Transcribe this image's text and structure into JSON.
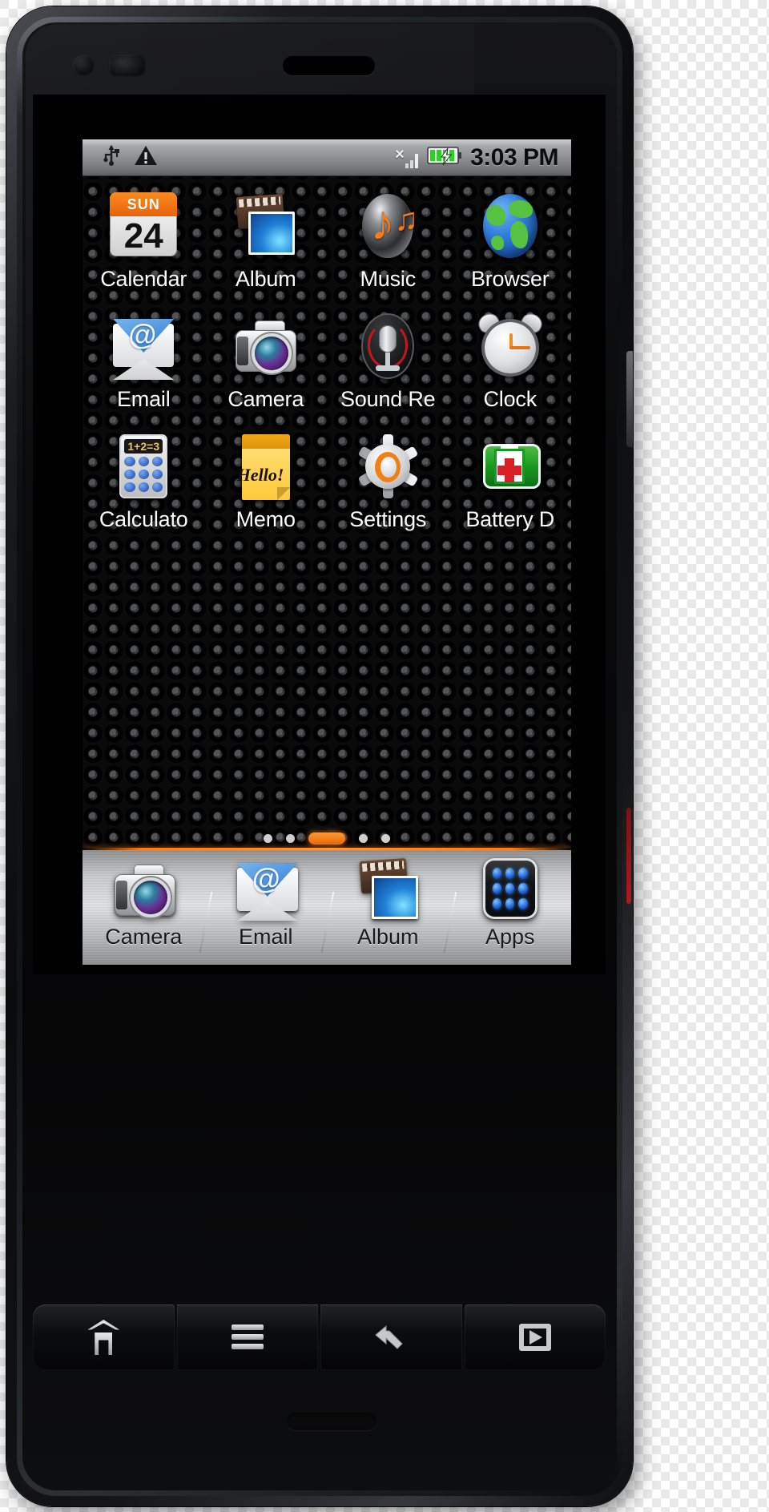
{
  "device": {
    "name": "android-smartphone",
    "front_camera": "front-camera",
    "proximity_sensor": "proximity-sensor",
    "earpiece": "earpiece-speaker",
    "bottom_mic": "bottom-microphone"
  },
  "statusbar": {
    "time": "3:03 PM",
    "icons": [
      {
        "name": "usb-icon",
        "glyph": "⑂"
      },
      {
        "name": "warning-icon",
        "glyph": "⚠"
      }
    ],
    "signal": {
      "name": "signal-no-service-icon",
      "x_mark": "×",
      "bars": 3,
      "active_bars": 0
    },
    "battery": {
      "name": "battery-charging-icon",
      "level": 4,
      "charging": true,
      "color": "#3ddc35"
    },
    "bar_color": "#9a9b9c"
  },
  "homescreen": {
    "rows": [
      {
        "apps": [
          {
            "name": "app-calendar",
            "label": "Calendar",
            "icon": "calendar-icon",
            "weekday": "SUN",
            "day": "24"
          },
          {
            "name": "app-album",
            "label": "Album",
            "icon": "album-icon"
          },
          {
            "name": "app-music",
            "label": "Music",
            "icon": "music-icon"
          },
          {
            "name": "app-browser",
            "label": "Browser",
            "icon": "browser-globe-icon"
          }
        ]
      },
      {
        "apps": [
          {
            "name": "app-email",
            "label": "Email",
            "icon": "email-envelope-icon",
            "at": "@"
          },
          {
            "name": "app-camera",
            "label": "Camera",
            "icon": "camera-icon"
          },
          {
            "name": "app-sound-recorder",
            "label": "Sound Re",
            "icon": "microphone-icon"
          },
          {
            "name": "app-clock",
            "label": "Clock",
            "icon": "alarm-clock-icon"
          }
        ]
      },
      {
        "apps": [
          {
            "name": "app-calculator",
            "label": "Calculato",
            "icon": "calculator-icon",
            "display": "1+2=3"
          },
          {
            "name": "app-memo",
            "label": "Memo",
            "icon": "memo-notepad-icon",
            "note": "Hello!"
          },
          {
            "name": "app-settings",
            "label": "Settings",
            "icon": "gear-icon"
          },
          {
            "name": "app-battery-doctor",
            "label": "Battery D",
            "icon": "battery-doctor-icon"
          }
        ]
      }
    ],
    "page_indicator": {
      "name": "page-indicator",
      "total": 5,
      "active": 3,
      "active_color": "#ff7a12"
    }
  },
  "dock": {
    "items": [
      {
        "name": "dock-camera",
        "label": "Camera",
        "icon": "camera-icon"
      },
      {
        "name": "dock-email",
        "label": "Email",
        "icon": "email-envelope-icon",
        "at": "@"
      },
      {
        "name": "dock-album",
        "label": "Album",
        "icon": "album-icon"
      },
      {
        "name": "dock-apps",
        "label": "Apps",
        "icon": "apps-drawer-icon"
      }
    ]
  },
  "navbar": {
    "keys": [
      {
        "name": "nav-home-button",
        "icon": "home-icon"
      },
      {
        "name": "nav-menu-button",
        "icon": "menu-icon"
      },
      {
        "name": "nav-back-button",
        "icon": "back-arrow-icon"
      },
      {
        "name": "nav-play-button",
        "icon": "play-icon"
      }
    ]
  }
}
